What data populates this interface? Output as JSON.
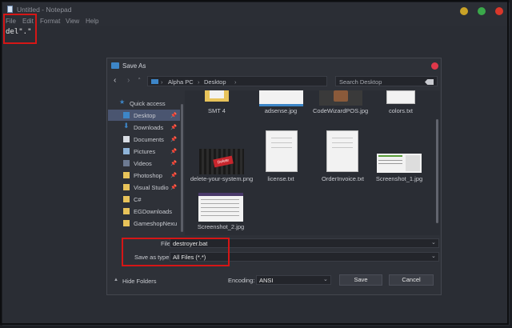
{
  "notepad": {
    "title": "Untitled - Notepad",
    "menu": [
      "File",
      "Edit",
      "Format",
      "View",
      "Help"
    ],
    "content": "del\".\""
  },
  "dialog": {
    "title": "Save As",
    "breadcrumb": [
      "Alpha PC",
      "Desktop"
    ],
    "search_placeholder": "Search Desktop",
    "sidebar": [
      {
        "label": "Quick access",
        "icon": "star-icon"
      },
      {
        "label": "Desktop",
        "icon": "folder-blue-icon",
        "selected": true,
        "pinned": true
      },
      {
        "label": "Downloads",
        "icon": "download-icon",
        "pinned": true
      },
      {
        "label": "Documents",
        "icon": "document-icon",
        "pinned": true
      },
      {
        "label": "Pictures",
        "icon": "picture-icon",
        "pinned": true
      },
      {
        "label": "Videos",
        "icon": "video-icon",
        "pinned": true
      },
      {
        "label": "Photoshop",
        "icon": "folder-icon",
        "pinned": true
      },
      {
        "label": "Visual Studio",
        "icon": "folder-icon",
        "pinned": true
      },
      {
        "label": "C#",
        "icon": "folder-icon"
      },
      {
        "label": "EGDownloads",
        "icon": "folder-icon"
      },
      {
        "label": "GameshopNexu",
        "icon": "folder-icon"
      }
    ],
    "files": [
      {
        "name": "SMT 4"
      },
      {
        "name": "adsense.jpg"
      },
      {
        "name": "CodeWizardPOS.jpg"
      },
      {
        "name": "colors.txt"
      },
      {
        "name": "delete-your-system.png"
      },
      {
        "name": "license.txt"
      },
      {
        "name": "OrderInvoice.txt"
      },
      {
        "name": "Screenshot_1.jpg"
      },
      {
        "name": "Screenshot_2.jpg"
      }
    ],
    "delete_badge": "Delete",
    "file_name_label": "File name:",
    "file_name_value": "destroyer.bat",
    "save_type_label": "Save as type:",
    "save_type_value": "All Files  (*.*)",
    "hide_folders": "Hide Folders",
    "encoding_label": "Encoding:",
    "encoding_value": "ANSI",
    "save_button": "Save",
    "cancel_button": "Cancel"
  },
  "colors": {
    "accent_blue": "#3d86c8",
    "highlight_red": "#d51616",
    "selected_bg": "#4a5570"
  }
}
